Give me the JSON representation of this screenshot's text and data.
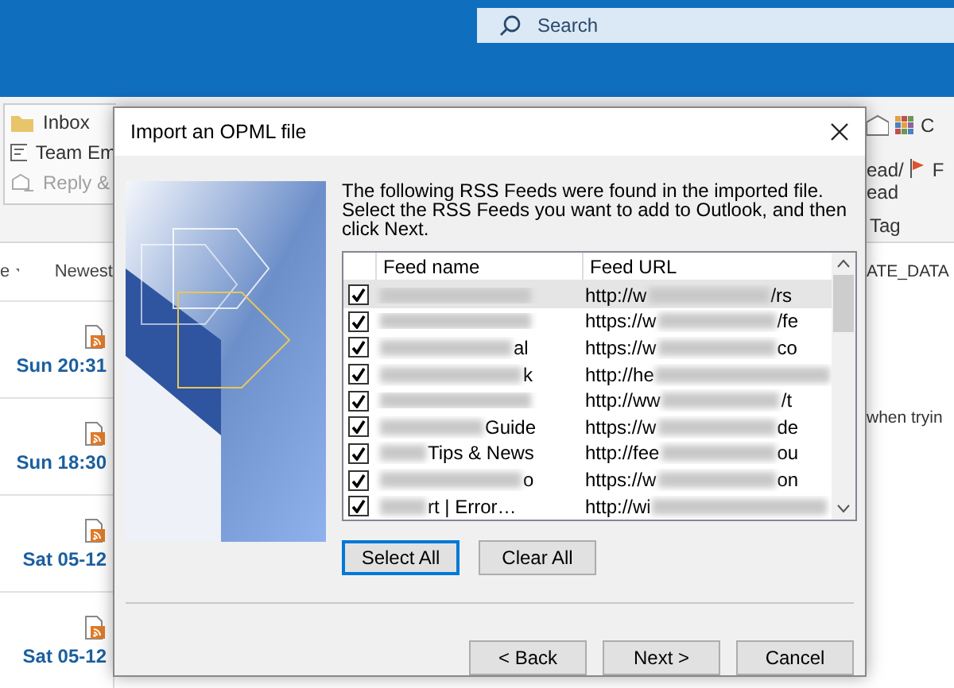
{
  "app": {
    "search": {
      "placeholder": "Search"
    },
    "ribbon_left": [
      {
        "label": "Inbox",
        "kind": "folder",
        "disabled": false
      },
      {
        "label": "Team Em",
        "kind": "mail",
        "disabled": false
      },
      {
        "label": "Reply &",
        "kind": "reply",
        "disabled": true
      }
    ],
    "ribbon_right": {
      "categorize": "C",
      "read_unread": [
        "ead/",
        "ead"
      ],
      "flag": "F",
      "group_label": "Tag"
    },
    "message_list": {
      "sort_label": "e",
      "sort_order": "Newest",
      "items": [
        {
          "time": "Sun 20:31"
        },
        {
          "time": "Sun 18:30"
        },
        {
          "time": "Sat 05-12"
        },
        {
          "time": "Sat 05-12"
        }
      ]
    },
    "reading_pane": {
      "lines": [
        "ATE_DATA",
        "when tryin"
      ]
    }
  },
  "dialog": {
    "title": "Import an OPML file",
    "intro": "The following RSS Feeds were found in the imported file. Select the RSS Feeds you want to add to Outlook, and then click Next.",
    "columns": [
      "Feed name",
      "Feed URL"
    ],
    "rows": [
      {
        "checked": true,
        "selected": true,
        "name_tail": "",
        "url_prefix": "http://w",
        "url_suffix": "/rs"
      },
      {
        "checked": true,
        "selected": false,
        "name_tail": "",
        "url_prefix": "https://w",
        "url_suffix": "/fe"
      },
      {
        "checked": true,
        "selected": false,
        "name_tail": "al",
        "url_prefix": "https://w",
        "url_suffix": "co"
      },
      {
        "checked": true,
        "selected": false,
        "name_tail": "k",
        "url_prefix": "http://he",
        "url_suffix": ""
      },
      {
        "checked": true,
        "selected": false,
        "name_tail": "",
        "url_prefix": "http://ww",
        "url_suffix": "/t"
      },
      {
        "checked": true,
        "selected": false,
        "name_tail": "Guide",
        "url_prefix": "https://w",
        "url_suffix": "de"
      },
      {
        "checked": true,
        "selected": false,
        "name_tail": "Tips & News",
        "url_prefix": "http://fee",
        "url_suffix": "ou"
      },
      {
        "checked": true,
        "selected": false,
        "name_tail": "o",
        "url_prefix": "https://w",
        "url_suffix": "on"
      },
      {
        "checked": true,
        "selected": false,
        "name_tail": "rt | Error…",
        "url_prefix": "http://wi",
        "url_suffix": ""
      }
    ],
    "list_buttons": [
      {
        "label": "Select All",
        "focused": true
      },
      {
        "label": "Clear All",
        "focused": false
      }
    ],
    "footer_buttons": [
      "< Back",
      "Next >",
      "Cancel"
    ]
  }
}
